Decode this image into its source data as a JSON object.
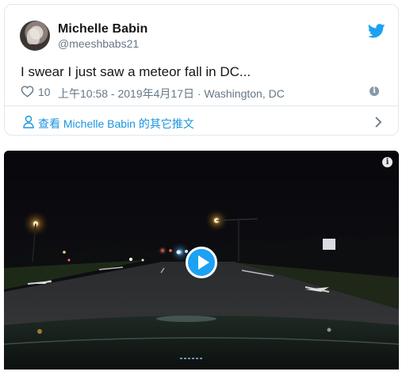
{
  "tweet": {
    "author_name": "Michelle Babin",
    "author_handle": "@meeshbabs21",
    "text": "I swear I just saw a meteor fall in DC...",
    "likes": "10",
    "timestamp": "上午10:58 - 2019年4月17日 · Washington, DC",
    "more_tweets_label": "查看 Michelle Babin 的其它推文"
  },
  "icons": {
    "brand": "twitter-bird-icon",
    "like": "heart-icon",
    "info": "info-icon",
    "profile": "person-icon",
    "next": "chevron-right-icon",
    "video_play": "play-icon"
  },
  "colors": {
    "twitter_blue": "#1da1f2",
    "link_blue": "#1b95e0",
    "secondary_text": "#657786",
    "border": "#e1e8ed"
  }
}
